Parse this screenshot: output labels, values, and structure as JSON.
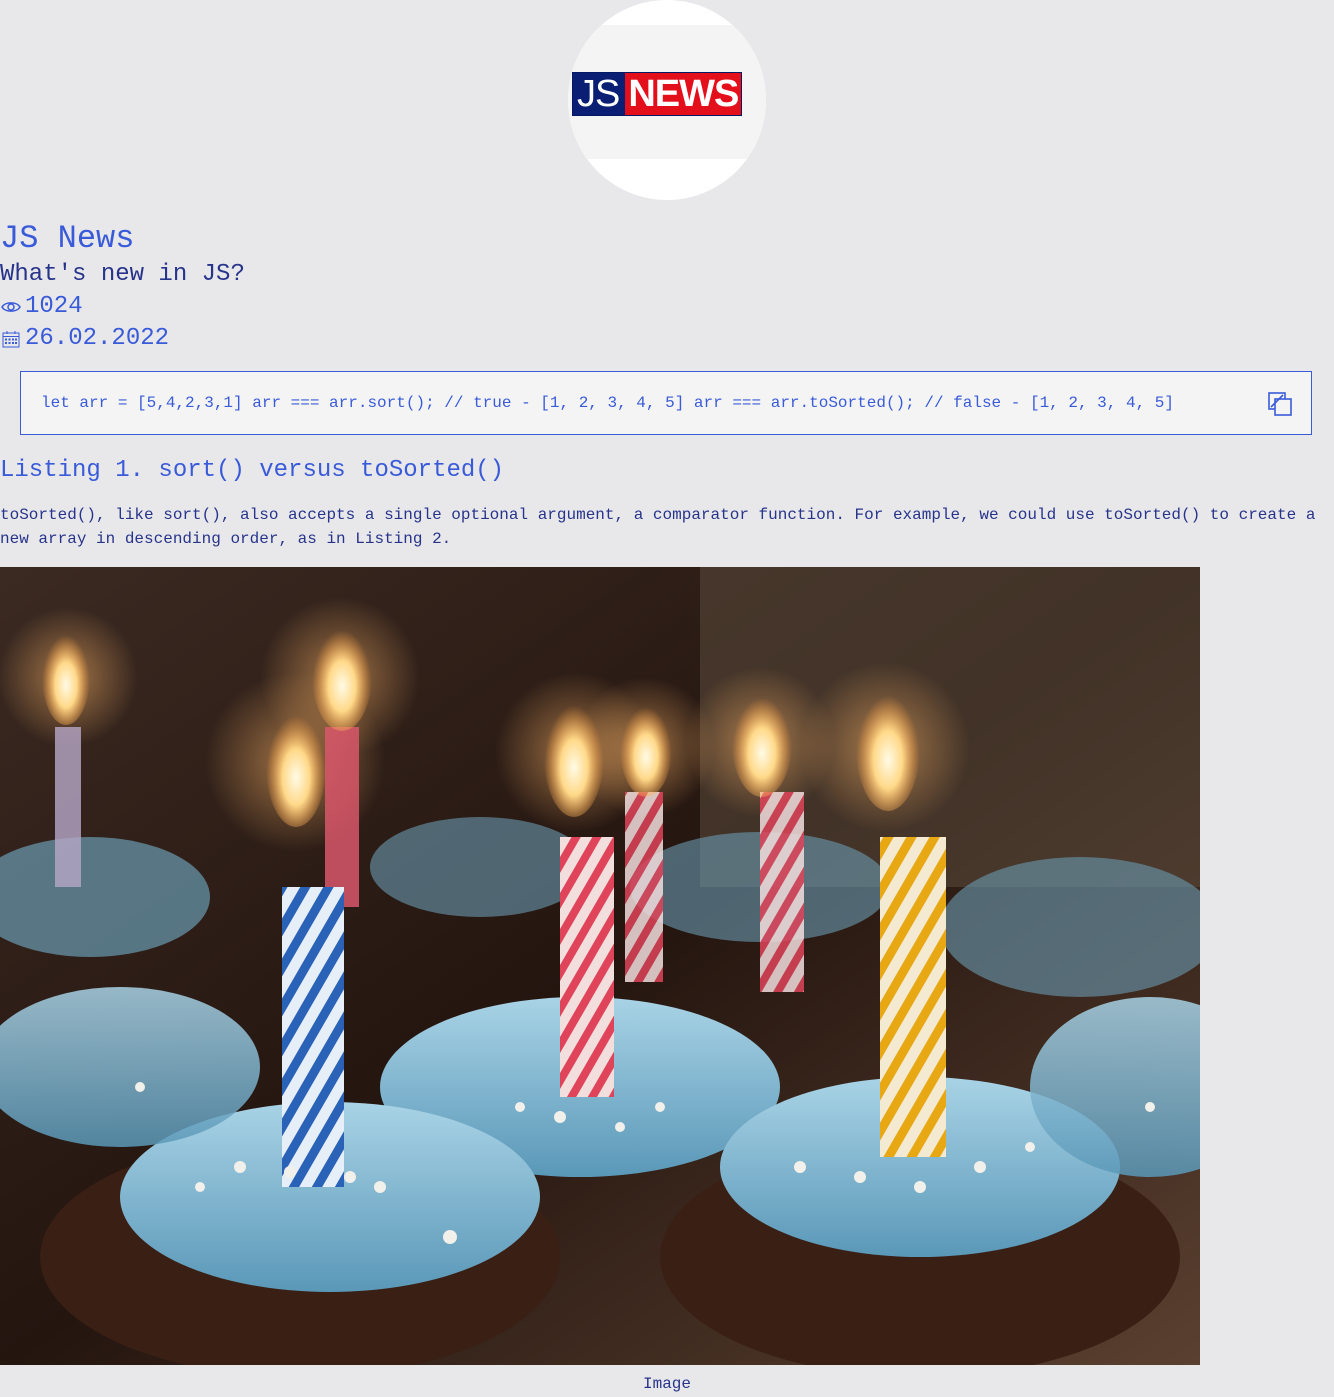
{
  "logo": {
    "part1": "JS",
    "part2": "NEWS"
  },
  "header": {
    "title": "JS News",
    "subtitle": "What's new in JS?"
  },
  "meta": {
    "views": "1024",
    "date": "26.02.2022",
    "views_icon": "eye-icon",
    "date_icon": "calendar-icon"
  },
  "code": {
    "text": "let arr = [5,4,2,3,1] arr === arr.sort(); // true - [1, 2, 3, 4, 5] arr === arr.toSorted(); // false - [1, 2, 3, 4, 5]",
    "copy_icon": "copy-icon"
  },
  "listing": {
    "title": "Listing 1. sort() versus toSorted()"
  },
  "article": {
    "paragraph": "toSorted(), like sort(), also accepts a single optional argument, a comparator function. For example, we could use toSorted() to create a new array in descending order, as in Listing 2."
  },
  "figure": {
    "caption": "Image"
  },
  "colors": {
    "accent": "#3a5bd9",
    "text": "#27348b",
    "background": "#e8e8ea",
    "logo_blue": "#0a1f73",
    "logo_red": "#e3101c"
  }
}
